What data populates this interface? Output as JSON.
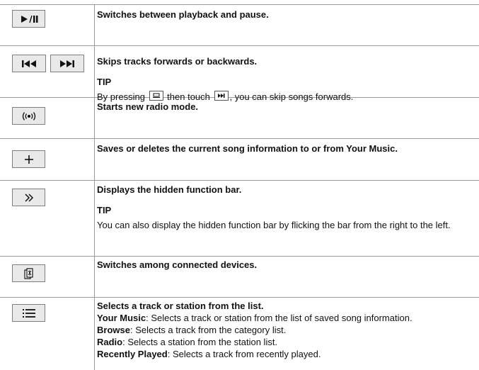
{
  "rows": [
    {
      "title": "Switches between playback and pause.",
      "icons": [
        "play-pause-icon"
      ]
    },
    {
      "title": "Skips tracks forwards or backwards.",
      "tip_heading": "TIP",
      "tip_before": "By pressing",
      "tip_middle": "then touch",
      "tip_after": ", you can skip songs forwards.",
      "icons": [
        "skip-back-icon",
        "skip-forward-icon",
        "home-key-icon",
        "skip-forward-small-icon"
      ]
    },
    {
      "title": "Starts new radio mode.",
      "icons": [
        "radio-broadcast-icon"
      ]
    },
    {
      "title": "Saves or deletes the current song information to or from Your Music.",
      "icons": [
        "plus-icon"
      ]
    },
    {
      "title": "Displays the hidden function bar.",
      "tip_heading": "TIP",
      "tip_text": "You can also display the hidden function bar by flicking the bar from the right to the left.",
      "icons": [
        "double-chevron-right-icon"
      ]
    },
    {
      "title": "Switches among connected devices.",
      "icons": [
        "device-switch-icon"
      ]
    },
    {
      "title": "Selects a track or station from the list.",
      "icons": [
        "list-icon"
      ],
      "items": [
        {
          "term": "Your Music",
          "desc": ": Selects a track or station from the list of saved song information."
        },
        {
          "term": "Browse",
          "desc": ": Selects a track from the category list."
        },
        {
          "term": "Radio",
          "desc": ": Selects a station from the station list."
        },
        {
          "term": "Recently Played",
          "desc": ": Selects a track from recently played."
        }
      ]
    }
  ]
}
